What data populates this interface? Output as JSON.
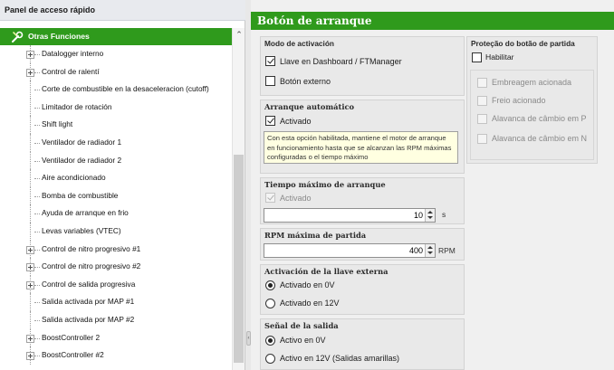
{
  "left_panel": {
    "title": "Panel de acceso rápido",
    "root": {
      "label": "Otras Funciones",
      "icon": "tools-icon"
    },
    "items": [
      {
        "label": "Datalogger interno",
        "expandable": true
      },
      {
        "label": "Control de ralentí",
        "expandable": true
      },
      {
        "label": "Corte de combustible en la desaceleracion (cutoff)",
        "expandable": false
      },
      {
        "label": "Limitador de rotación",
        "expandable": false
      },
      {
        "label": "Shift light",
        "expandable": false
      },
      {
        "label": "Ventilador de radiador 1",
        "expandable": false
      },
      {
        "label": "Ventilador de radiador 2",
        "expandable": false
      },
      {
        "label": "Aire acondicionado",
        "expandable": false
      },
      {
        "label": "Bomba de combustible",
        "expandable": false
      },
      {
        "label": "Ayuda de arranque en frio",
        "expandable": false
      },
      {
        "label": "Levas variables (VTEC)",
        "expandable": false
      },
      {
        "label": "Control de nitro progresivo #1",
        "expandable": true
      },
      {
        "label": "Control de nitro progresivo #2",
        "expandable": true
      },
      {
        "label": "Control de salida progresiva",
        "expandable": true
      },
      {
        "label": "Salida activada por MAP #1",
        "expandable": false
      },
      {
        "label": "Salida activada por MAP #2",
        "expandable": false
      },
      {
        "label": "BoostController 2",
        "expandable": true
      },
      {
        "label": "BoostController #2",
        "expandable": true
      }
    ]
  },
  "right_panel": {
    "title": "Botón de arranque",
    "modo": {
      "title": "Modo de activación",
      "opt1": {
        "label": "Llave en Dashboard / FTManager",
        "checked": true
      },
      "opt2": {
        "label": "Botón externo",
        "checked": false
      }
    },
    "arranque": {
      "title": "Arranque automático",
      "opt": {
        "label": "Activado",
        "checked": true
      },
      "tooltip": "Con esta opción habilitada, mantiene el motor de arranque en funcionamiento hasta que se alcanzan las RPM máximas configuradas o el tiempo máximo"
    },
    "tiempo": {
      "title": "Tiempo máximo de arranque",
      "opt": {
        "label": "Activado",
        "checked": true
      },
      "value": "10",
      "unit": "s"
    },
    "rpm": {
      "title": "RPM máxima de partida",
      "value": "400",
      "unit": "RPM"
    },
    "llave": {
      "title": "Activación de la llave externa",
      "opt1": {
        "label": "Activado en 0V",
        "checked": true
      },
      "opt2": {
        "label": "Activado en 12V",
        "checked": false
      }
    },
    "salida": {
      "title": "Señal de la salida",
      "opt1": {
        "label": "Activo en 0V",
        "checked": true
      },
      "opt2": {
        "label": "Activo en 12V (Salidas amarillas)",
        "checked": false
      }
    },
    "protecao": {
      "title": "Proteção do botão de partida",
      "habilitar": {
        "label": "Habilitar",
        "checked": false
      },
      "opts": [
        {
          "label": "Embreagem acionada"
        },
        {
          "label": "Freio acionado"
        },
        {
          "label": "Alavanca de câmbio em P"
        },
        {
          "label": "Alavanca de câmbio em N"
        }
      ]
    }
  }
}
